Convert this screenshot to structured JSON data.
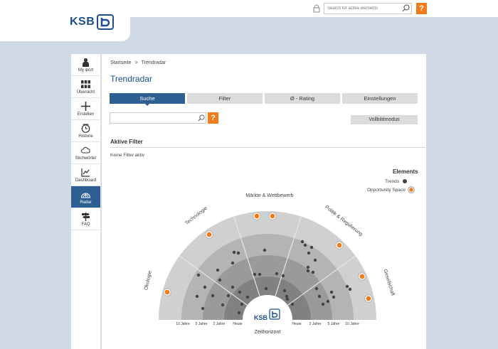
{
  "brand": {
    "name": "KSB"
  },
  "header": {
    "search_placeholder": "Search for active elements",
    "help_label": "?"
  },
  "sidebar": {
    "items": [
      {
        "label": "My iport",
        "icon": "person-icon"
      },
      {
        "label": "Übersicht",
        "icon": "grid-icon"
      },
      {
        "label": "Erstellen",
        "icon": "plus-icon"
      },
      {
        "label": "Historie",
        "icon": "clock-icon"
      },
      {
        "label": "Stichwörter",
        "icon": "cloud-icon"
      },
      {
        "label": "Dashboard",
        "icon": "chart-icon"
      },
      {
        "label": "Radar",
        "icon": "radar-icon",
        "active": true
      },
      {
        "label": "FAQ",
        "icon": "signpost-icon"
      }
    ]
  },
  "breadcrumb": {
    "home": "Startseite",
    "sep": ">",
    "current": "Trendradar"
  },
  "page_title": "Trendradar",
  "tabs": [
    {
      "label": "Suche",
      "active": true
    },
    {
      "label": "Filter"
    },
    {
      "label": "Ø - Rating"
    },
    {
      "label": "Einstellungen"
    }
  ],
  "search": {
    "placeholder": "",
    "help_label": "?"
  },
  "vollbild_label": "Vollbildmodus",
  "filters": {
    "heading": "Aktive Filter",
    "empty_text": "Keine Filter aktiv"
  },
  "legend": {
    "title": "Elements",
    "items": [
      {
        "label": "Trends",
        "marker": "dark-dot"
      },
      {
        "label": "Opportunity Space",
        "marker": "orange-ring-dot"
      }
    ]
  },
  "radar": {
    "sectors": [
      "Ökologie",
      "Technologie",
      "Märkte & Wettbewerb",
      "Politik & Regulierung",
      "Gesellschaft"
    ],
    "axis_left": [
      "10 Jahre",
      "5 Jahre",
      "2 Jahre",
      "Heute"
    ],
    "axis_right": [
      "Heute",
      "2 Jahre",
      "5 Jahre",
      "10 Jahre"
    ],
    "axis_title": "Zeithorizont",
    "center_logo": "KSB"
  },
  "colors": {
    "brand_blue": "#2e5f93",
    "orange": "#f07c1a",
    "ring_outer": "#d0d0d0",
    "ring_3": "#b4b4b4",
    "ring_2": "#9a9a9a",
    "ring_1": "#818181"
  }
}
